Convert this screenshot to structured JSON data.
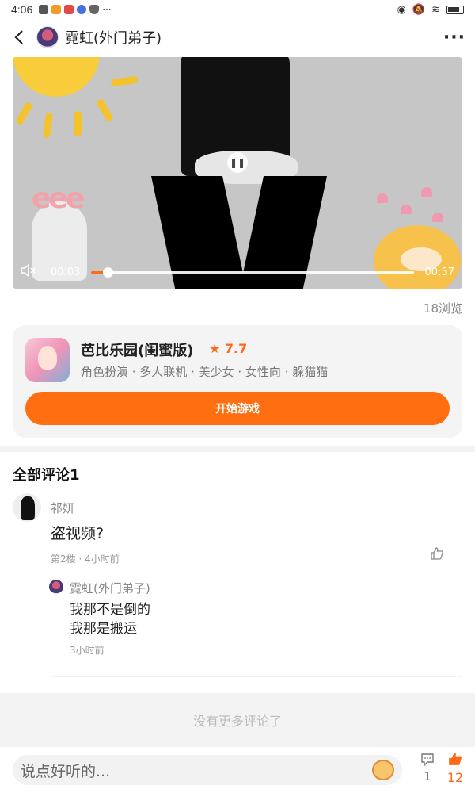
{
  "status": {
    "time": "4:06"
  },
  "header": {
    "title": "霓虹(外门弟子)",
    "more_icon": "more-dots-icon"
  },
  "video": {
    "current_time": "00:03",
    "duration": "00:57",
    "progress_percent": 5,
    "state": "paused"
  },
  "views": "18浏览",
  "game": {
    "name": "芭比乐园(闺蜜版)",
    "rating": "7.7",
    "tags": "角色扮演 · 多人联机 · 美少女 · 女性向 · 躲猫猫",
    "button_label": "开始游戏"
  },
  "comments_title": "全部评论1",
  "comment": {
    "author": "祁妍",
    "text": "盗视频?",
    "meta": "第2楼 · 4小时前",
    "reply": {
      "author": "霓虹(外门弟子)",
      "line1": "我那不是倒的",
      "line2": "我那是搬运",
      "meta": "3小时前"
    }
  },
  "no_more": "没有更多评论了",
  "bottom": {
    "input_placeholder": "说点好听的...",
    "comment_count": "1",
    "like_count": "12"
  },
  "colors": {
    "accent": "#ff6f12",
    "background": "#ffffff"
  }
}
